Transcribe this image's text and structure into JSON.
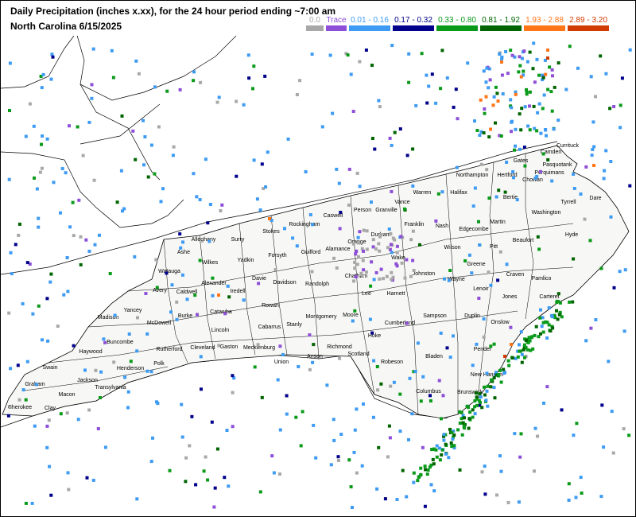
{
  "title": {
    "line1": "Daily Precipitation (inches  x.xx),  for the 24 hour period ending ~7:00 am",
    "line2": "North Carolina 6/15/2025"
  },
  "legend": [
    {
      "label": "0.0",
      "color": "#a8a8a8"
    },
    {
      "label": "Trace",
      "color": "#8e4fd8"
    },
    {
      "label": "0.01 - 0.16",
      "color": "#3d9bf3"
    },
    {
      "label": "0.17 - 0.32",
      "color": "#00008b"
    },
    {
      "label": "0.33 - 0.80",
      "color": "#0a9a1a"
    },
    {
      "label": "0.81 - 1.92",
      "color": "#006400"
    },
    {
      "label": "1.93 - 2.88",
      "color": "#ff7518"
    },
    {
      "label": "2.89 - 3.20",
      "color": "#d13a00"
    }
  ],
  "counties": [
    "Alleghany",
    "Surry",
    "Stokes",
    "Rockingham",
    "Caswell",
    "Person",
    "Granville",
    "Vance",
    "Warren",
    "Northampton",
    "Hertford",
    "Gates",
    "Camden",
    "Currituck",
    "Pasquotank",
    "Perquimans",
    "Chowan",
    "Bertie",
    "Halifax",
    "Franklin",
    "Nash",
    "Edgecombe",
    "Martin",
    "Washington",
    "Tyrrell",
    "Dare",
    "Hyde",
    "Beaufort",
    "Pitt",
    "Wilson",
    "Johnston",
    "Wake",
    "Durham",
    "Orange",
    "Alamance",
    "Guilford",
    "Forsyth",
    "Yadkin",
    "Wilkes",
    "Ashe",
    "Watauga",
    "Avery",
    "Caldwell",
    "Alexander",
    "Iredell",
    "Davie",
    "Davidson",
    "Randolph",
    "Chatham",
    "Lee",
    "Harnett",
    "Wayne",
    "Greene",
    "Lenoir",
    "Craven",
    "Pamlico",
    "Jones",
    "Onslow",
    "Duplin",
    "Sampson",
    "Cumberland",
    "Hoke",
    "Moore",
    "Montgomery",
    "Stanly",
    "Rowan",
    "Cabarrus",
    "Mecklenburg",
    "Gaston",
    "Cleveland",
    "Lincoln",
    "Catawba",
    "Burke",
    "McDowell",
    "Rutherford",
    "Polk",
    "Henderson",
    "Buncombe",
    "Madison",
    "Yancey",
    "Haywood",
    "Swain",
    "Graham",
    "Cherokee",
    "Clay",
    "Macon",
    "Jackson",
    "Transylvania",
    "Union",
    "Anson",
    "Richmond",
    "Scotland",
    "Robeson",
    "Bladen",
    "Columbus",
    "Brunswick",
    "Pender",
    "New Hanover",
    "Carteret"
  ]
}
